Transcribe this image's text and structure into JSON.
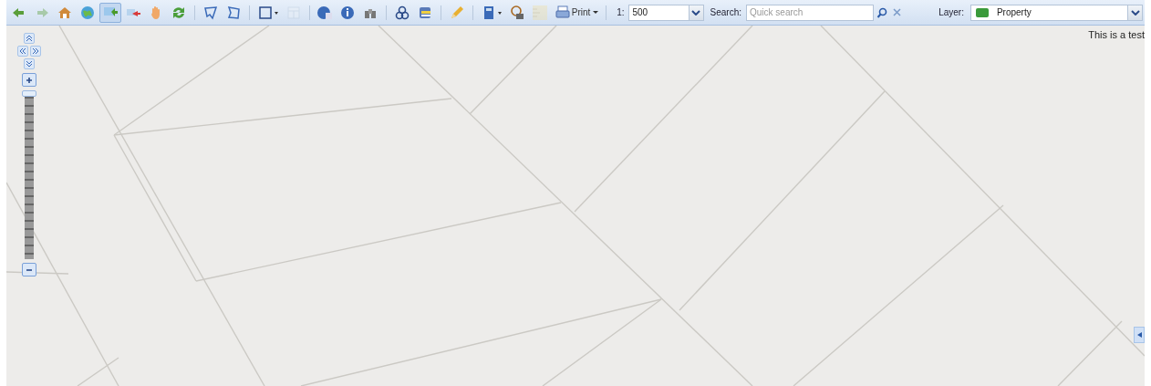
{
  "toolbar": {
    "tools": [
      {
        "kind": "tool",
        "selected": false,
        "disabled": false
      },
      {
        "kind": "tool",
        "selected": false,
        "disabled": true
      },
      {
        "kind": "tool",
        "selected": false,
        "disabled": false
      },
      {
        "kind": "tool",
        "selected": false,
        "disabled": false
      },
      {
        "kind": "tool",
        "selected": true,
        "disabled": false
      },
      {
        "kind": "tool",
        "selected": false,
        "disabled": false
      },
      {
        "kind": "tool",
        "selected": false,
        "disabled": false
      },
      {
        "kind": "tool",
        "selected": false,
        "disabled": false
      },
      {
        "kind": "separator"
      },
      {
        "kind": "tool",
        "selected": false,
        "disabled": false
      },
      {
        "kind": "tool",
        "selected": false,
        "disabled": false
      },
      {
        "kind": "separator"
      },
      {
        "kind": "dropdown",
        "selected": false,
        "disabled": false
      },
      {
        "kind": "tool",
        "selected": false,
        "disabled": true
      },
      {
        "kind": "separator"
      },
      {
        "kind": "tool",
        "selected": false,
        "disabled": false
      },
      {
        "kind": "tool",
        "selected": false,
        "disabled": false
      },
      {
        "kind": "tool",
        "selected": false,
        "disabled": false
      },
      {
        "kind": "separator"
      },
      {
        "kind": "tool",
        "selected": false,
        "disabled": false
      },
      {
        "kind": "tool",
        "selected": false,
        "disabled": false
      },
      {
        "kind": "separator"
      },
      {
        "kind": "tool",
        "selected": false,
        "disabled": false
      },
      {
        "kind": "separator"
      },
      {
        "kind": "dropdown",
        "selected": false,
        "disabled": false
      },
      {
        "kind": "tool",
        "selected": false,
        "disabled": false
      },
      {
        "kind": "tool",
        "selected": false,
        "disabled": true
      },
      {
        "kind": "menu",
        "label": "Print",
        "selected": false,
        "disabled": false
      },
      {
        "kind": "separator"
      }
    ],
    "scale": {
      "label": "1:",
      "value": "500"
    },
    "search": {
      "label": "Search:",
      "placeholder": "Quick search"
    },
    "layer": {
      "label": "Layer:",
      "value": "Property"
    }
  },
  "map": {
    "notice": "This is a test",
    "zoom": {
      "level": 1.0
    }
  }
}
